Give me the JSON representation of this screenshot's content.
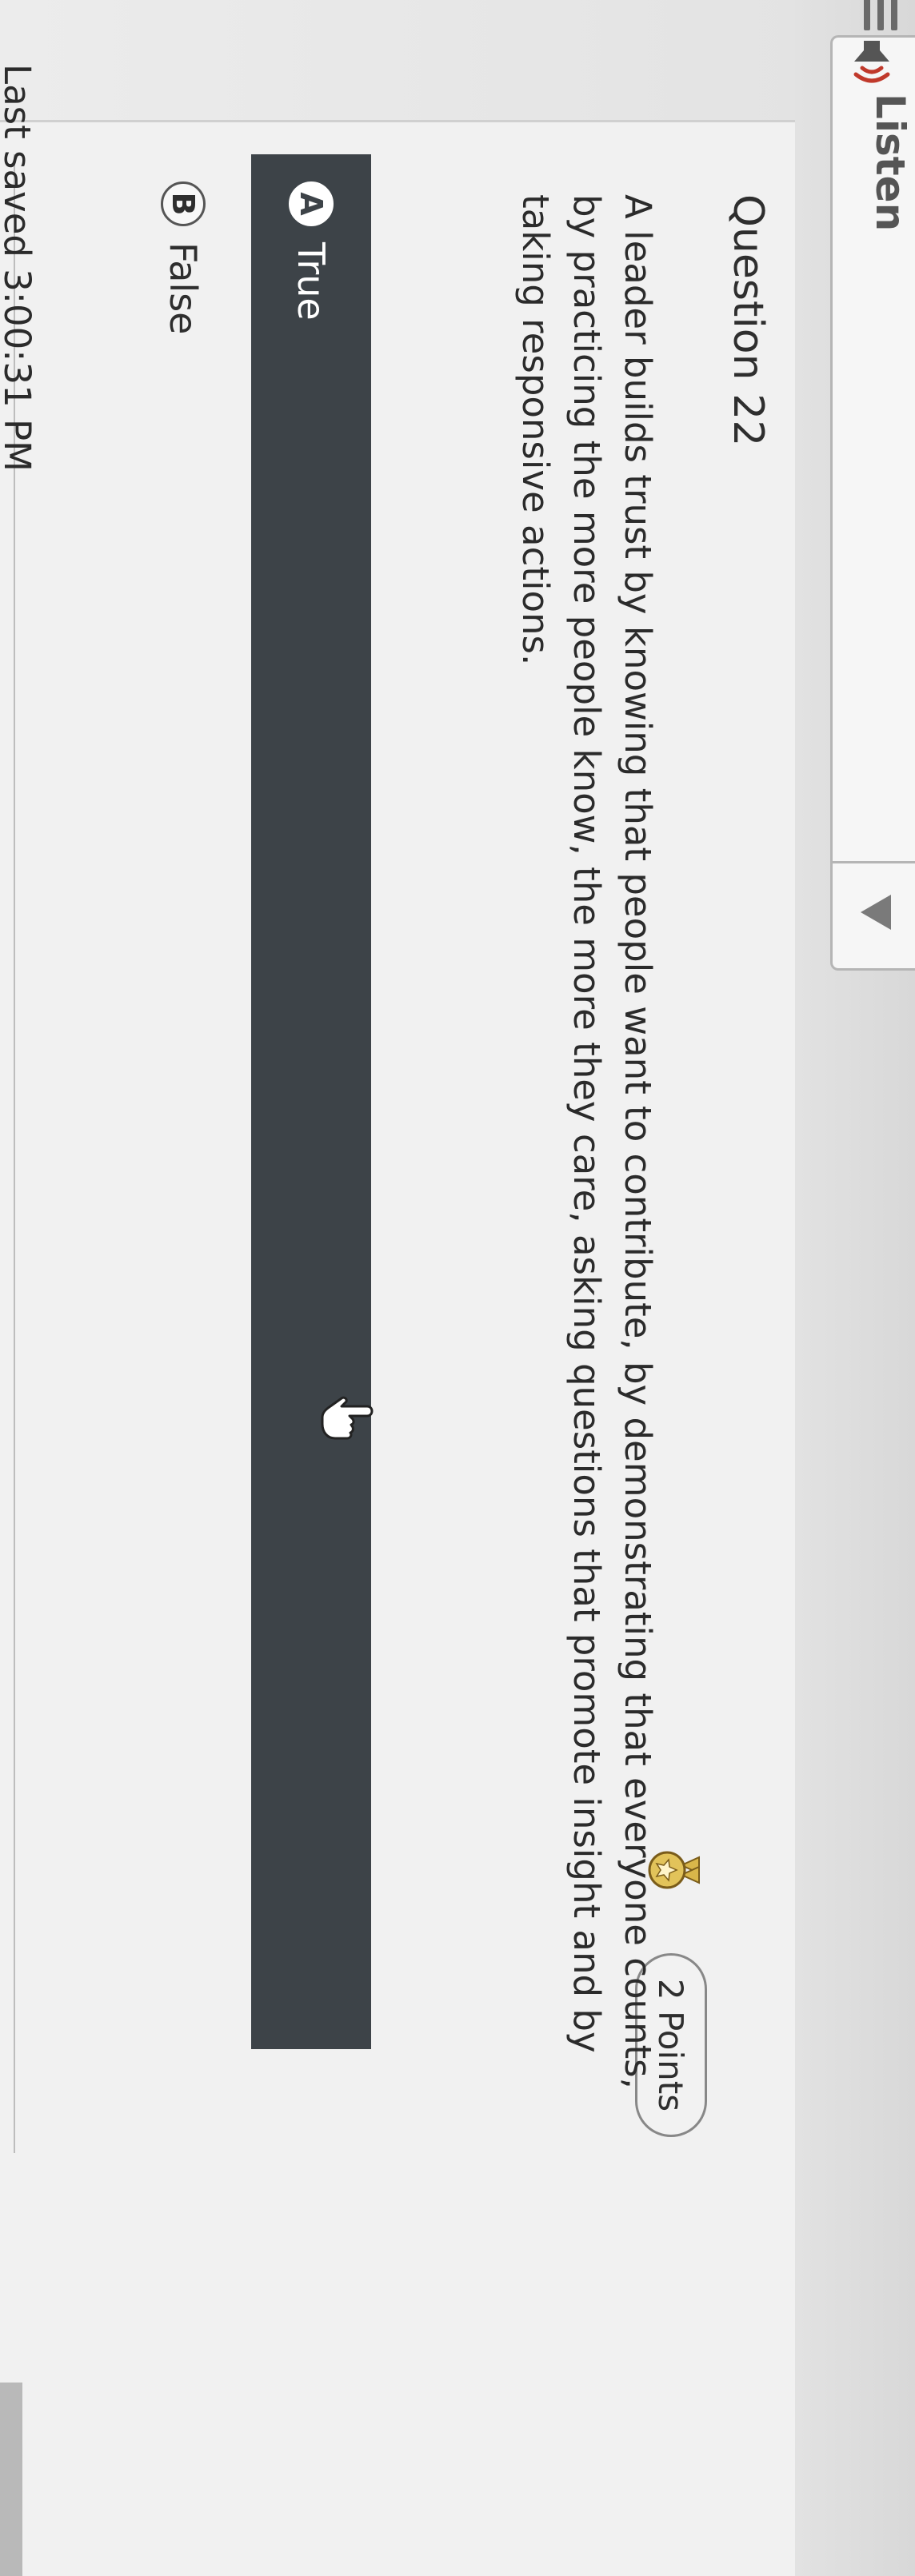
{
  "toolbar": {
    "listen_label": "Listen"
  },
  "question": {
    "title": "Question 22",
    "points": "2 Points",
    "prompt": "A leader builds trust by knowing that people want to contribute, by demonstrating that everyone counts, by practicing the more people know, the more they care, asking questions that promote insight and by taking responsive actions."
  },
  "choices": [
    {
      "letter": "A",
      "label": "True",
      "selected": true
    },
    {
      "letter": "B",
      "label": "False",
      "selected": false
    }
  ],
  "footer": {
    "last_saved": "Last saved 3:00:31 PM"
  },
  "colors": {
    "selected_choice_bg": "#3d4348",
    "card_bg": "#f1f1f1"
  },
  "icons": {
    "menu": "menu-icon",
    "speaker": "speaker-icon",
    "play": "play-icon",
    "award": "award-icon",
    "cursor": "cursor-icon"
  }
}
